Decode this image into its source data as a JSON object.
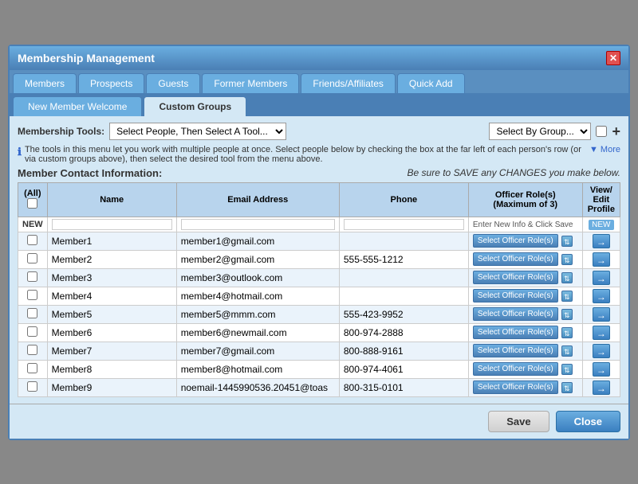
{
  "modal": {
    "title": "Membership Management",
    "close_label": "✕"
  },
  "tabs_row1": [
    {
      "label": "Members",
      "active": false
    },
    {
      "label": "Prospects",
      "active": false
    },
    {
      "label": "Guests",
      "active": false
    },
    {
      "label": "Former Members",
      "active": false
    },
    {
      "label": "Friends/Affiliates",
      "active": false
    },
    {
      "label": "Quick Add",
      "active": false
    }
  ],
  "tabs_row2": [
    {
      "label": "New Member Welcome",
      "active": false
    },
    {
      "label": "Custom Groups",
      "active": true
    }
  ],
  "tools": {
    "label": "Membership Tools:",
    "select_default": "Select People, Then Select A Tool...",
    "group_select_default": "Select By Group...",
    "plus_label": "+"
  },
  "info_text": "The tools in this menu let you work with multiple people at once. Select people below by checking the box at the far left of each person's row (or via custom groups above), then select the desired tool from the menu above.",
  "more_label": "▼ More",
  "section_title": "Member Contact Information:",
  "save_reminder": "Be sure to SAVE any CHANGES you make below.",
  "table": {
    "headers": [
      "(All)",
      "Name",
      "Email Address",
      "Phone",
      "Officer Role(s)\n(Maximum of 3)",
      "View/\nEdit\nProfile"
    ],
    "new_row": {
      "label": "NEW",
      "enter_text": "Enter New Info & Click Save",
      "new_badge": "NEW"
    },
    "members": [
      {
        "name": "Member1",
        "email": "member1@gmail.com",
        "phone": "",
        "role_btn": "Select Officer Role(s)"
      },
      {
        "name": "Member2",
        "email": "member2@gmail.com",
        "phone": "555-555-1212",
        "role_btn": "Select Officer Role(s)"
      },
      {
        "name": "Member3",
        "email": "member3@outlook.com",
        "phone": "",
        "role_btn": "Select Officer Role(s)"
      },
      {
        "name": "Member4",
        "email": "member4@hotmail.com",
        "phone": "",
        "role_btn": "Select Officer Role(s)"
      },
      {
        "name": "Member5",
        "email": "member5@mmm.com",
        "phone": "555-423-9952",
        "role_btn": "Select Officer Role(s)"
      },
      {
        "name": "Member6",
        "email": "member6@newmail.com",
        "phone": "800-974-2888",
        "role_btn": "Select Officer Role(s)"
      },
      {
        "name": "Member7",
        "email": "member7@gmail.com",
        "phone": "800-888-9161",
        "role_btn": "Select Officer Role(s)"
      },
      {
        "name": "Member8",
        "email": "member8@hotmail.com",
        "phone": "800-974-4061",
        "role_btn": "Select Officer Role(s)"
      },
      {
        "name": "Member9",
        "email": "noemail-1445990536.20451@toas",
        "phone": "800-315-0101",
        "role_btn": "Select Officer Role(s)"
      }
    ]
  },
  "bottom_buttons": {
    "save": "Save",
    "close": "Close"
  }
}
